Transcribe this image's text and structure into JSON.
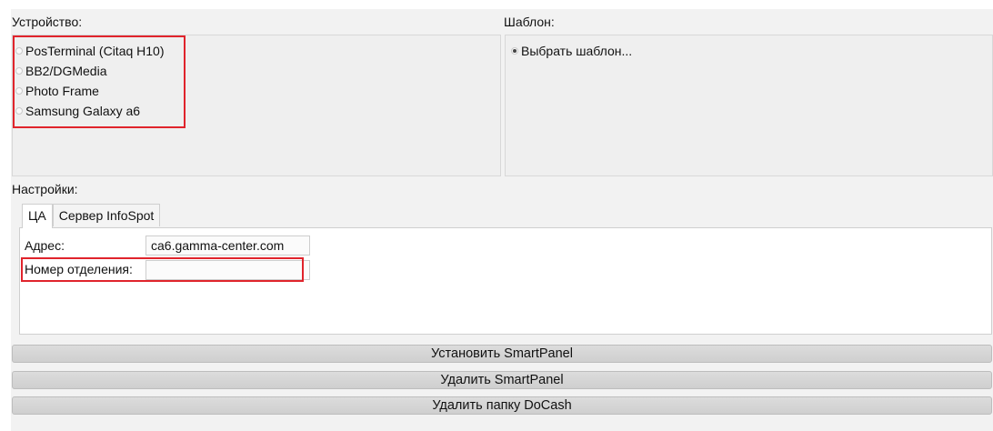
{
  "device_section": {
    "label": "Устройство:",
    "options": [
      {
        "label": "PosTerminal (Citaq H10)",
        "checked": false
      },
      {
        "label": "BB2/DGMedia",
        "checked": false
      },
      {
        "label": "Photo Frame",
        "checked": false
      },
      {
        "label": "Samsung Galaxy a6",
        "checked": false
      }
    ]
  },
  "template_section": {
    "label": "Шаблон:",
    "options": [
      {
        "label": "Выбрать шаблон...",
        "checked": true
      }
    ]
  },
  "settings_section": {
    "label": "Настройки:",
    "tabs": [
      {
        "label": "ЦА",
        "active": true
      },
      {
        "label": "Сервер InfoSpot",
        "active": false
      }
    ],
    "fields": {
      "address_label": "Адрес:",
      "address_value": "ca6.gamma-center.com",
      "branch_label": "Номер отделения:",
      "branch_value": ""
    }
  },
  "buttons": {
    "install": "Установить SmartPanel",
    "remove": "Удалить SmartPanel",
    "remove_folder": "Удалить папку DoCash"
  },
  "colors": {
    "highlight": "#e0242c",
    "window_bg": "#f2f2f2"
  }
}
